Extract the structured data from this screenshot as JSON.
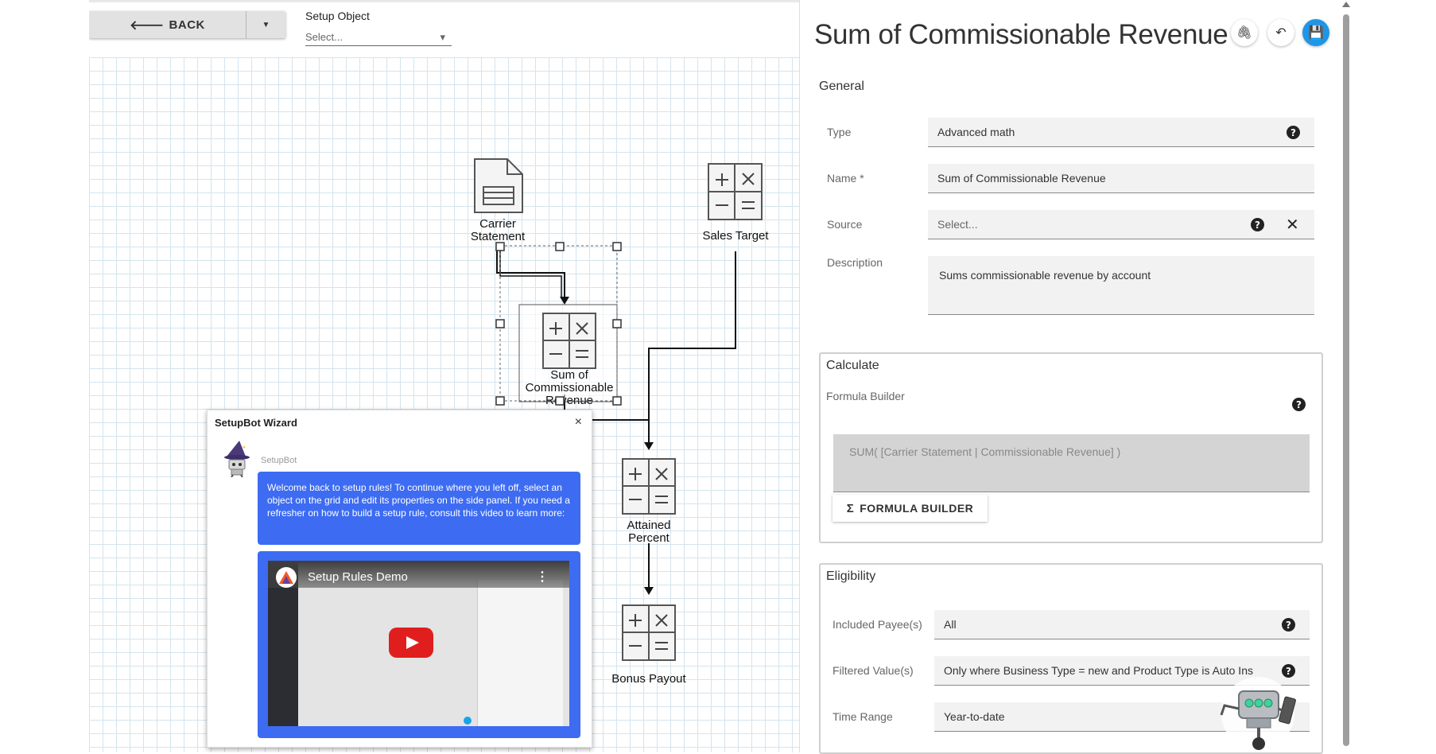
{
  "toolbar": {
    "back_label": "BACK",
    "back_arrow": "🡐",
    "dropdown_caret": "▼"
  },
  "setup_object": {
    "label": "Setup Object",
    "placeholder": "Select...",
    "caret": "▾"
  },
  "diagram": {
    "nodes": [
      {
        "label_lines": [
          "Carrier",
          "Statement"
        ],
        "icon": "document-icon"
      },
      {
        "label_lines": [
          "Sales Target"
        ],
        "icon": "calculator-icon"
      },
      {
        "label_lines": [
          "Sum of",
          "Commissionable",
          "Revenue"
        ],
        "icon": "calculator-icon",
        "selected": true
      },
      {
        "label_lines": [
          "Attained",
          "Percent"
        ],
        "icon": "calculator-icon"
      },
      {
        "label_lines": [
          "Bonus Payout"
        ],
        "icon": "calculator-icon"
      }
    ]
  },
  "wizard": {
    "title": "SetupBot Wizard",
    "close": "×",
    "bot_name": "SetupBot",
    "message": "Welcome back to setup rules! To continue where you left off, select an object on the grid and edit its properties on the side panel. If you need a refresher on how to build a setup rule, consult this video to learn more:",
    "video_title": "Setup Rules Demo",
    "video_menu": "⋮"
  },
  "panel": {
    "title": "Sum of Commissionable Revenue",
    "attach_icon": "🖇",
    "undo_icon": "↶",
    "save_icon": "💾",
    "general_heading": "General",
    "help_glyph": "?",
    "clear_glyph": "✕",
    "fields": {
      "type": {
        "label": "Type",
        "value": "Advanced math"
      },
      "name": {
        "label": "Name *",
        "value": "Sum of Commissionable Revenue"
      },
      "source": {
        "label": "Source",
        "placeholder": "Select..."
      },
      "description": {
        "label": "Description",
        "value": "Sums commissionable revenue by account"
      }
    },
    "calculate": {
      "title": "Calculate",
      "formula_label": "Formula Builder",
      "formula": "SUM( [Carrier Statement | Commissionable Revenue] )",
      "button_icon": "Σ",
      "button_label": "FORMULA BUILDER"
    },
    "eligibility": {
      "title": "Eligibility",
      "included_payees": {
        "label": "Included Payee(s)",
        "value": "All"
      },
      "filtered_values": {
        "label": "Filtered Value(s)",
        "value": "Only where Business Type = new and Product Type is Auto Ins"
      },
      "time_range": {
        "label": "Time Range",
        "value": "Year-to-date"
      }
    }
  },
  "colors": {
    "accent_blue": "#3d6cf2",
    "save_blue": "#1e96e8",
    "grid_line": "#d5e4ee"
  }
}
